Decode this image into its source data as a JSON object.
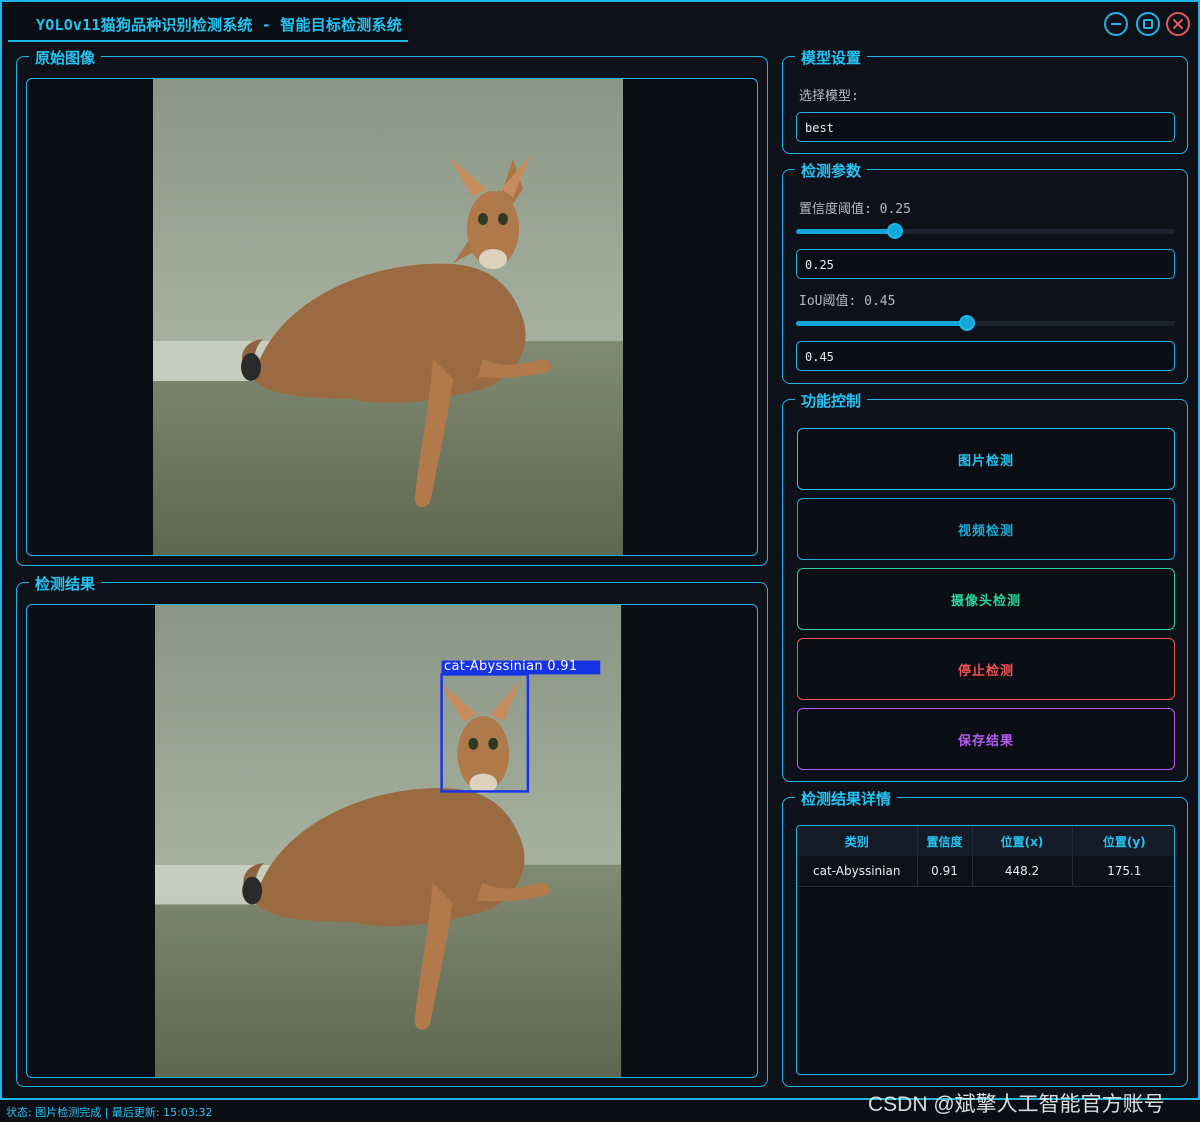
{
  "window": {
    "title": "YOLOv11猫狗品种识别检测系统 - 智能目标检测系统"
  },
  "original_panel": {
    "title": "原始图像"
  },
  "result_panel": {
    "title": "检测结果",
    "box_label": "cat-Abyssinian 0.91",
    "box_color": "#1733e6"
  },
  "model_settings": {
    "title": "模型设置",
    "select_label": "选择模型:",
    "selected_model": "best"
  },
  "detect_params": {
    "title": "检测参数",
    "confidence": {
      "label": "置信度阈值: 0.25",
      "value": "0.25",
      "level": 0.26
    },
    "iou": {
      "label": "IoU阈值: 0.45",
      "value": "0.45",
      "level": 0.45
    }
  },
  "controls": {
    "title": "功能控制",
    "buttons": [
      {
        "label": "图片检测",
        "color": "#24c4f2"
      },
      {
        "label": "视频检测",
        "color": "#1ea8d6"
      },
      {
        "label": "摄像头检测",
        "color": "#2bd39b"
      },
      {
        "label": "停止检测",
        "color": "#f05252"
      },
      {
        "label": "保存结果",
        "color": "#b35cf0"
      }
    ]
  },
  "details": {
    "title": "检测结果详情",
    "columns": [
      "类别",
      "置信度",
      "位置(x)",
      "位置(y)"
    ],
    "rows": [
      [
        "cat-Abyssinian",
        "0.91",
        "448.2",
        "175.1"
      ]
    ]
  },
  "status": {
    "text": "状态: 图片检测完成 | 最后更新: 15:03:32"
  },
  "watermark": "CSDN @斌擎人工智能官方账号",
  "colors": {
    "accent": "#1fb6e6",
    "background": "#0e111a"
  }
}
